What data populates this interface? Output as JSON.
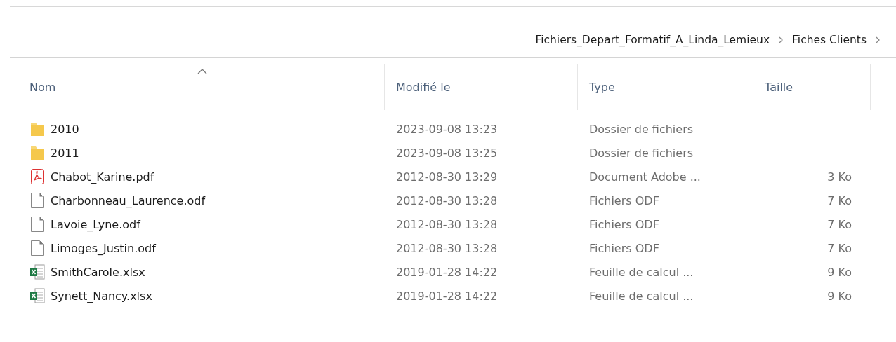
{
  "breadcrumb": [
    {
      "label": "Fichiers_Depart_Formatif_A_Linda_Lemieux"
    },
    {
      "label": "Fiches Clients"
    }
  ],
  "columns": [
    {
      "label": "Nom",
      "sorted": true
    },
    {
      "label": "Modifié le",
      "sorted": false
    },
    {
      "label": "Type",
      "sorted": false
    },
    {
      "label": "Taille",
      "sorted": false
    }
  ],
  "rows": [
    {
      "kind": "folder",
      "name": "2010",
      "modified": "2023-09-08 13:23",
      "type": "Dossier de fichiers"
    },
    {
      "kind": "folder",
      "name": "2011",
      "modified": "2023-09-08 13:25",
      "type": "Dossier de fichiers"
    },
    {
      "kind": "pdf",
      "name": "Chabot_Karine.pdf",
      "modified": "2012-08-30 13:29",
      "type": "Document Adobe ...",
      "size": "3 Ko"
    },
    {
      "kind": "document",
      "name": "Charbonneau_Laurence.odf",
      "modified": "2012-08-30 13:28",
      "type": "Fichiers ODF",
      "size": "7 Ko"
    },
    {
      "kind": "document",
      "name": "Lavoie_Lyne.odf",
      "modified": "2012-08-30 13:28",
      "type": "Fichiers ODF",
      "size": "7 Ko"
    },
    {
      "kind": "document",
      "name": "Limoges_Justin.odf",
      "modified": "2012-08-30 13:28",
      "type": "Fichiers ODF",
      "size": "7 Ko"
    },
    {
      "kind": "spreadsheet",
      "name": "SmithCarole.xlsx",
      "modified": "2019-01-28 14:22",
      "type": "Feuille de calcul ...",
      "size": "9 Ko"
    },
    {
      "kind": "spreadsheet",
      "name": "Synett_Nancy.xlsx",
      "modified": "2019-01-28 14:22",
      "type": "Feuille de calcul ...",
      "size": "9 Ko"
    }
  ]
}
